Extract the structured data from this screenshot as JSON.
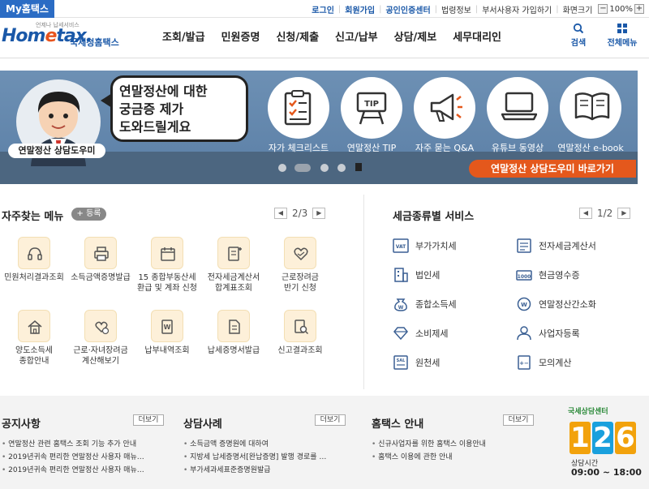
{
  "topbar": {
    "my_hometax": "My홈택스",
    "links": [
      "로그인",
      "회원가입",
      "공인인증센터",
      "법령정보",
      "부서사용자 가입하기",
      "화면크기"
    ],
    "zoom_minus": "−",
    "zoom_value": "100%",
    "zoom_plus": "+"
  },
  "header": {
    "logo_word_a": "Hom",
    "logo_word_e": "e",
    "logo_word_b": "tax.",
    "logo_tag": "언제나 납세서비스",
    "logo_sub": "국세청홈택스",
    "nav": [
      "조회/발급",
      "민원증명",
      "신청/제출",
      "신고/납부",
      "상담/제보",
      "세무대리인"
    ],
    "search_label": "검색",
    "menu_label": "전체메뉴"
  },
  "banner": {
    "bubble_lines": [
      "연말정산에 대한",
      "궁금증 제가",
      "도와드릴게요"
    ],
    "mascot_label": "연말정산 상담도우미",
    "items": [
      {
        "label": "자가 체크리스트",
        "icon": "checklist-icon"
      },
      {
        "label": "연말정산 TIP",
        "icon": "tip-board-icon"
      },
      {
        "label": "자주 묻는 Q&A",
        "icon": "megaphone-icon"
      },
      {
        "label": "유튜브 동영상",
        "icon": "laptop-icon"
      },
      {
        "label": "연말정산 e-book",
        "icon": "book-icon"
      }
    ],
    "cta": "연말정산 상담도우미 바로가기",
    "accent": "#e4581c"
  },
  "favorites": {
    "title": "자주찾는 메뉴",
    "add_label": "+ 등록",
    "page": "2/3",
    "items": [
      {
        "lines": [
          "민원처리결과조회"
        ]
      },
      {
        "lines": [
          "소득금액증명발급"
        ]
      },
      {
        "lines": [
          "15 종합부동산세",
          "환급 및 계좌 신청"
        ]
      },
      {
        "lines": [
          "전자세금계산서",
          "합계표조회"
        ]
      },
      {
        "lines": [
          "근로장려금",
          "반기 신청"
        ]
      },
      {
        "lines": [
          "양도소득세",
          "종합안내"
        ]
      },
      {
        "lines": [
          "근로·자녀장려금",
          "계산해보기"
        ]
      },
      {
        "lines": [
          "납부내역조회"
        ]
      },
      {
        "lines": [
          "납세증명서발급"
        ]
      },
      {
        "lines": [
          "신고결과조회"
        ]
      }
    ]
  },
  "tax_services": {
    "title": "세금종류별 서비스",
    "page": "1/2",
    "items": [
      "부가가치세",
      "전자세금계산서",
      "법인세",
      "현금영수증",
      "종합소득세",
      "연말정산간소화",
      "소비제세",
      "사업자등록",
      "원천세",
      "모의계산"
    ]
  },
  "boards": [
    {
      "title": "공지사항",
      "more": "더보기",
      "items": [
        "연말정산 관련 홈택스 조회 기능 추가 안내",
        "2019년귀속 편리한 연말정산 사용자 매뉴…",
        "2019년귀속 편리한 연말정산 사용자 매뉴…"
      ]
    },
    {
      "title": "상담사례",
      "more": "더보기",
      "items": [
        "소득금액 증명원에 대하여",
        "지방세 납세증명서[완납증명] 발행 경로를 …",
        "부가세과세표준증명원발급"
      ]
    },
    {
      "title": "홈택스 안내",
      "more": "더보기",
      "items": [
        "신규사업자를 위한 홈택스 이용안내",
        "홈택스 이용에 관한 안내"
      ]
    }
  ],
  "call_center": {
    "title": "국세상담센터",
    "digits": [
      "1",
      "2",
      "6"
    ],
    "digit_colors": [
      "#f2a20c",
      "#1aa0dd",
      "#f2a20c"
    ],
    "hours_label": "상담시간",
    "hours": "09:00 ~ 18:00"
  }
}
